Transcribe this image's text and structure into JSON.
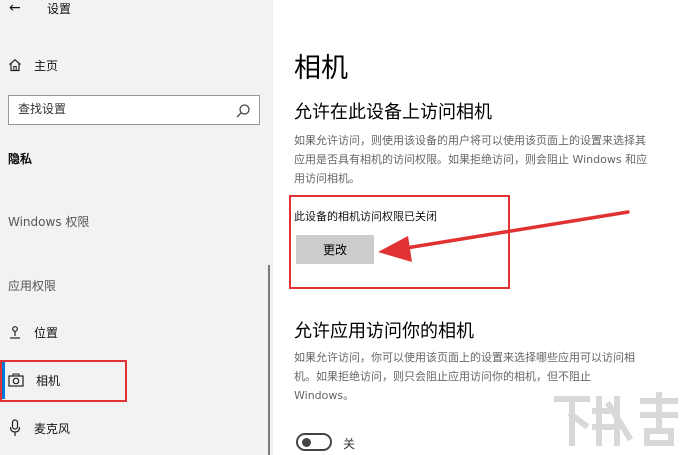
{
  "window": {
    "back_icon": "back-arrow-icon",
    "title": "设置"
  },
  "sidebar": {
    "home_label": "主页",
    "home_icon": "home-icon",
    "search_placeholder": "查找设置",
    "search_icon": "search-icon",
    "section_title": "隐私",
    "group_windows": "Windows 权限",
    "group_app": "应用权限",
    "items": [
      {
        "label": "位置",
        "icon": "location-icon",
        "selected": false
      },
      {
        "label": "相机",
        "icon": "camera-icon",
        "selected": true
      },
      {
        "label": "麦克风",
        "icon": "microphone-icon",
        "selected": false
      }
    ]
  },
  "main": {
    "title": "相机",
    "section1": {
      "heading": "允许在此设备上访问相机",
      "desc_lines": [
        "如果允许访问，则使用该设备的用户将可以使用该页面上的设置来选择其",
        "应用是否具有相机的访问权限。如果拒绝访问，则会阻止 Windows 和应",
        "用访问相机。"
      ],
      "status": "此设备的相机访问权限已关闭",
      "button_label": "更改"
    },
    "section2": {
      "heading": "允许应用访问你的相机",
      "desc_lines": [
        "如果允许访问，你可以使用该页面上的设置来选择哪些应用可以访问相",
        "机。如果拒绝访问，则只会阻止应用访问你的相机，但不阻止",
        "Windows。"
      ],
      "toggle_state": "off",
      "toggle_label": "关"
    }
  },
  "annotation": {
    "color": "#e03232"
  },
  "colors": {
    "accent": "#0078d7",
    "sidebar_bg": "#f2f2f2",
    "button_bg": "#cccccc"
  }
}
